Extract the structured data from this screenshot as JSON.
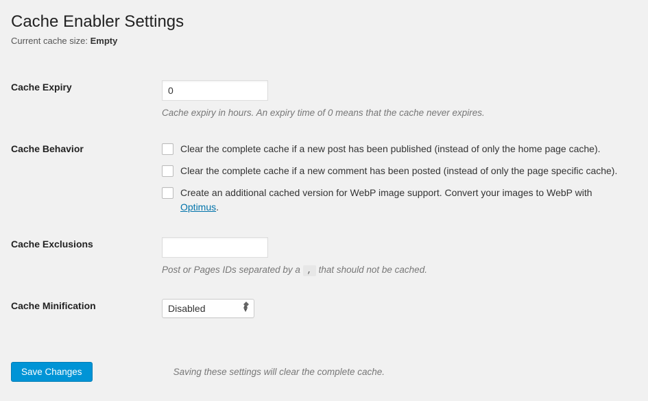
{
  "page": {
    "title": "Cache Enabler Settings",
    "cache_size_label": "Current cache size: ",
    "cache_size_value": "Empty"
  },
  "expiry": {
    "label": "Cache Expiry",
    "value": "0",
    "description": "Cache expiry in hours. An expiry time of 0 means that the cache never expires."
  },
  "behavior": {
    "label": "Cache Behavior",
    "items": {
      "clear_on_post": "Clear the complete cache if a new post has been published (instead of only the home page cache).",
      "clear_on_comment": "Clear the complete cache if a new comment has been posted (instead of only the page specific cache).",
      "webp_prefix": "Create an additional cached version for WebP image support. Convert your images to WebP with ",
      "webp_link": "Optimus",
      "webp_suffix": "."
    }
  },
  "exclusions": {
    "label": "Cache Exclusions",
    "value": "",
    "desc_prefix": "Post or Pages IDs separated by a ",
    "separator": ",",
    "desc_suffix": " that should not be cached."
  },
  "minification": {
    "label": "Cache Minification",
    "selected": "Disabled"
  },
  "footer": {
    "save_button": "Save Changes",
    "save_note": "Saving these settings will clear the complete cache."
  }
}
